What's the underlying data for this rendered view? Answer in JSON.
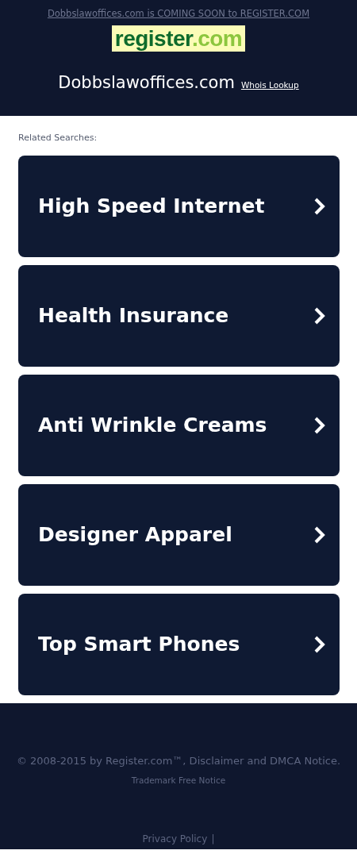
{
  "banner": {
    "text": "Dobbslawoffices.com is COMING SOON to REGISTER.COM"
  },
  "logo": {
    "word": "register",
    "suffix": ".com"
  },
  "domain": {
    "name": "Dobbslawoffices.com",
    "whois_link": "Whois Lookup"
  },
  "related": {
    "heading": "Related Searches:",
    "items": [
      {
        "label": "High Speed Internet"
      },
      {
        "label": "Health Insurance"
      },
      {
        "label": "Anti Wrinkle Creams"
      },
      {
        "label": "Designer Apparel"
      },
      {
        "label": "Top Smart Phones"
      }
    ]
  },
  "footer": {
    "copyright": "© 2008-2015 by Register.com™, Disclaimer and DMCA Notice.",
    "trademark_link": "Trademark Free Notice",
    "privacy_link": "Privacy Policy",
    "separator": "|"
  }
}
